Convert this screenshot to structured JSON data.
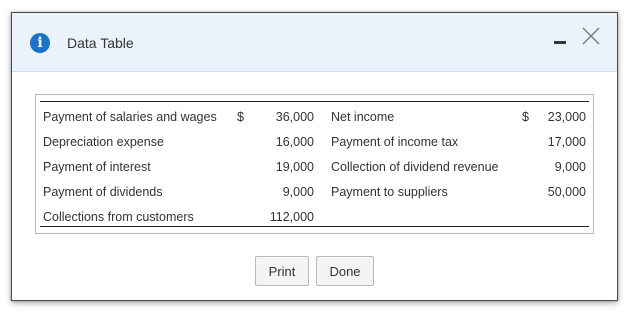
{
  "dialog": {
    "title": "Data Table",
    "print_label": "Print",
    "done_label": "Done"
  },
  "table": {
    "rows": [
      {
        "left_label": "Payment of salaries and wages",
        "left_dollar": "$",
        "left_value": "36,000",
        "right_label": "Net income",
        "right_dollar": "$",
        "right_value": "23,000"
      },
      {
        "left_label": "Depreciation expense",
        "left_dollar": "",
        "left_value": "16,000",
        "right_label": "Payment of income tax",
        "right_dollar": "",
        "right_value": "17,000"
      },
      {
        "left_label": "Payment of interest",
        "left_dollar": "",
        "left_value": "19,000",
        "right_label": "Collection of dividend revenue",
        "right_dollar": "",
        "right_value": "9,000"
      },
      {
        "left_label": "Payment of dividends",
        "left_dollar": "",
        "left_value": "9,000",
        "right_label": "Payment to suppliers",
        "right_dollar": "",
        "right_value": "50,000"
      },
      {
        "left_label": "Collections from customers",
        "left_dollar": "",
        "left_value": "112,000",
        "right_label": "",
        "right_dollar": "",
        "right_value": ""
      }
    ]
  },
  "icons": {
    "info": "info-icon",
    "minimize": "minimize-icon",
    "close": "close-icon"
  },
  "colors": {
    "titlebar_bg": "#eaf3fb",
    "info_icon": "#1a73c9"
  }
}
